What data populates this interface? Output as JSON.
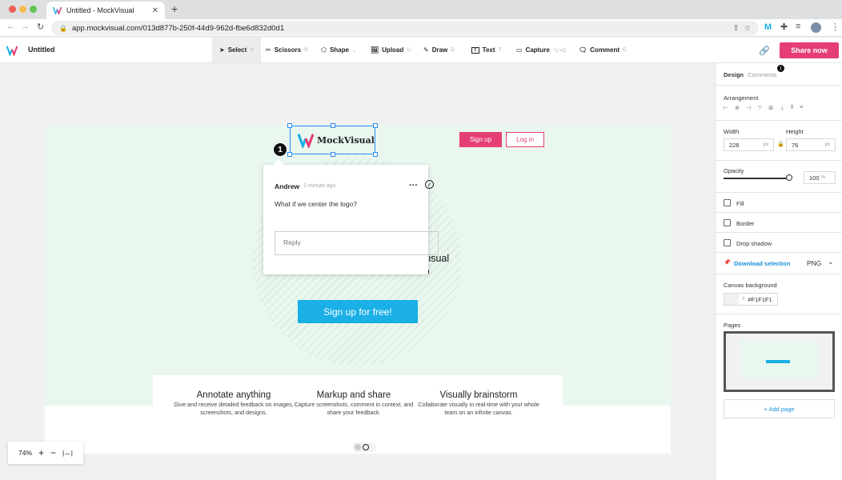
{
  "browser": {
    "tab_title": "Untitled - MockVisual",
    "url": "app.mockvisual.com/013d877b-250f-44d9-962d-fbe6d832d0d1"
  },
  "app": {
    "doc_title": "Untitled",
    "share_label": "Share now",
    "tools": [
      {
        "label": "Select",
        "key": "V"
      },
      {
        "label": "Scissors",
        "key": "S"
      },
      {
        "label": "Shape",
        "key": ""
      },
      {
        "label": "Upload",
        "key": "U"
      },
      {
        "label": "Draw",
        "key": "D"
      },
      {
        "label": "Text",
        "key": "T"
      },
      {
        "label": "Capture",
        "key": "⌥+G"
      },
      {
        "label": "Comment",
        "key": "C"
      }
    ]
  },
  "canvas": {
    "logo_text": "MockVisual",
    "signup": "Sign up",
    "login": "Log in",
    "hero": "rapidly iterate with an easy-to-use visual communication tool for the web",
    "cta": "Sign up for free!",
    "features": [
      {
        "title": "Annotate anything",
        "desc": "Give and receive detailed feedback on images, screenshots, and designs."
      },
      {
        "title": "Markup and share",
        "desc": "Capture screenshots, comment in context, and share your feedback."
      },
      {
        "title": "Visually brainstorm",
        "desc": "Collaborate visually in real-time with your whole team on an infinite canvas."
      }
    ]
  },
  "comment": {
    "pin": "1",
    "author": "Andrew",
    "time": "1 minute ago",
    "text": "What if we center the logo?",
    "reply_placeholder": "Reply"
  },
  "zoom": {
    "level": "74%"
  },
  "panel": {
    "tab_design": "Design",
    "tab_comments": "Comments",
    "comments_badge": "1",
    "arrangement": "Arrangement",
    "width_label": "Width",
    "height_label": "Height",
    "width": "228",
    "height": "76",
    "unit": "px",
    "opacity_label": "Opacity",
    "opacity": "100",
    "opacity_unit": "%",
    "opacity_value": 1.0,
    "fill": "Fill",
    "border": "Border",
    "shadow": "Drop shadow",
    "download": "Download selection",
    "format": "PNG",
    "canvas_bg_label": "Canvas background",
    "canvas_bg": "#F1F1F1",
    "pages_label": "Pages",
    "add_page": "+ Add page"
  },
  "colors": {
    "brand_pink": "#e53e74",
    "cta_blue": "#1aafe6",
    "select_blue": "#2a8bf2",
    "frame_mint": "#e9f7ef"
  }
}
